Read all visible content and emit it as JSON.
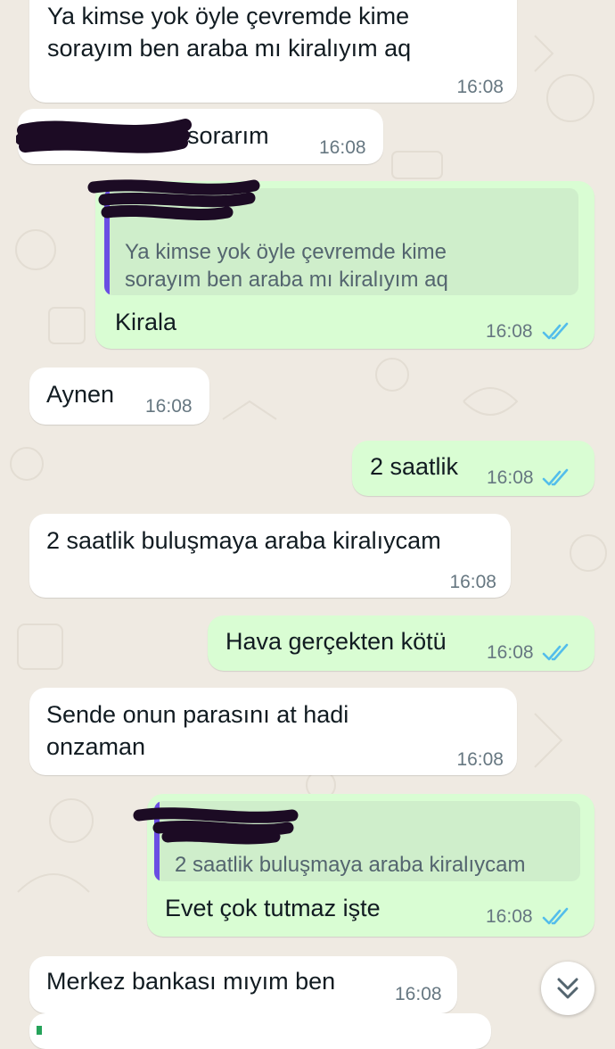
{
  "messages": [
    {
      "text": "Ya kimse yok öyle çevremde kime\nsorayım ben araba mı kiralıyım aq",
      "time": "16:08"
    },
    {
      "text": "abiye sorarım",
      "time": "16:08"
    },
    {
      "quote": "Ya kimse yok öyle çevremde kime\nsorayım ben araba mı kiralıyım aq",
      "text": "Kirala",
      "time": "16:08"
    },
    {
      "text": "Aynen",
      "time": "16:08"
    },
    {
      "text": "2 saatlik",
      "time": "16:08"
    },
    {
      "text": "2 saatlik buluşmaya araba kiralıycam",
      "time": "16:08"
    },
    {
      "text": "Hava gerçekten kötü",
      "time": "16:08"
    },
    {
      "text": "Sende onun parasını at hadi\nonzaman",
      "time": "16:08"
    },
    {
      "quote": "2 saatlik buluşmaya araba kiralıycam",
      "text": "Evet çok tutmaz işte",
      "time": "16:08"
    },
    {
      "text": "Merkez bankası mıyım ben",
      "time": "16:08"
    }
  ],
  "colors": {
    "background": "#efeae2",
    "incoming": "#ffffff",
    "outgoing": "#d9fdd3",
    "read_ticks": "#53bdeb",
    "quote_bar": "#6a4ee3"
  },
  "icons": {
    "scroll_down": "double-chevron-down-icon",
    "read_receipt": "double-check-icon"
  }
}
